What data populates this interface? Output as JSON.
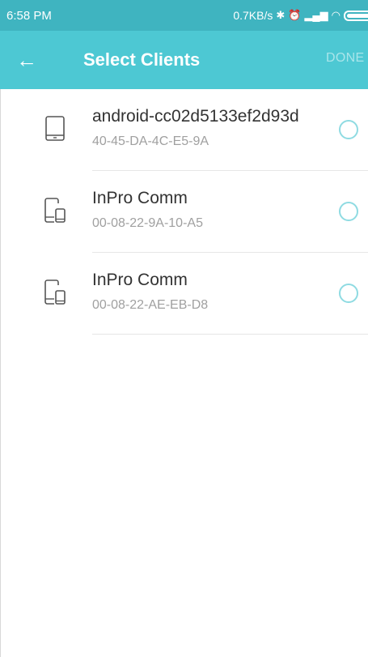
{
  "status_bar": {
    "time": "6:58 PM",
    "net_speed": "0.7KB/s",
    "icons": [
      "bluetooth-icon",
      "alarm-icon",
      "signal-icon",
      "wifi-icon",
      "battery-icon"
    ]
  },
  "app_bar": {
    "title": "Select Clients",
    "done_label": "DONE",
    "back_icon": "arrow-left-icon"
  },
  "clients": [
    {
      "name": "android-cc02d5133ef2d93d",
      "mac": "40-45-DA-4C-E5-9A",
      "icon": "tablet-icon"
    },
    {
      "name": "InPro Comm",
      "mac": "00-08-22-9A-10-A5",
      "icon": "tablet-phone-icon"
    },
    {
      "name": "InPro Comm",
      "mac": "00-08-22-AE-EB-D8",
      "icon": "tablet-phone-icon"
    }
  ],
  "colors": {
    "status_bar": "#3fb4c0",
    "app_bar": "#4dc8d3",
    "radio": "#8fdbe2"
  }
}
